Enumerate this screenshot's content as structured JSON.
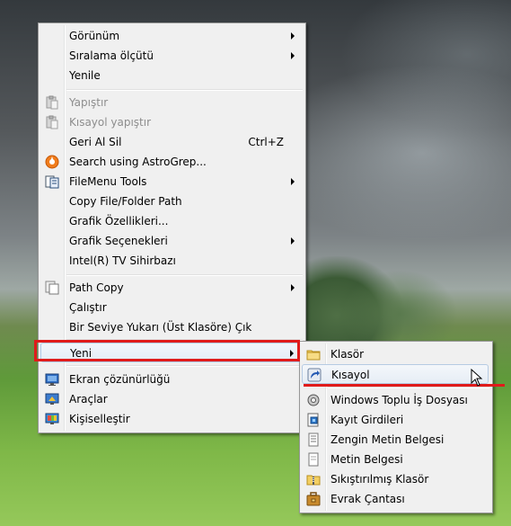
{
  "main_menu": {
    "items": [
      {
        "label": "Görünüm",
        "submenu": true
      },
      {
        "label": "Sıralama ölçütü",
        "submenu": true
      },
      {
        "label": "Yenile"
      },
      {
        "label": "Yapıştır",
        "disabled": true,
        "icon": "paste-icon"
      },
      {
        "label": "Kısayol yapıştır",
        "disabled": true,
        "icon": "paste-shortcut-icon"
      },
      {
        "label": "Geri Al Sil",
        "shortcut": "Ctrl+Z"
      },
      {
        "label": "Search using AstroGrep...",
        "icon": "astrogrep-icon"
      },
      {
        "label": "FileMenu Tools",
        "submenu": true,
        "icon": "filemenu-tools-icon"
      },
      {
        "label": "Copy File/Folder Path"
      },
      {
        "label": "Grafik Özellikleri..."
      },
      {
        "label": "Grafik Seçenekleri",
        "submenu": true
      },
      {
        "label": "Intel(R) TV Sihirbazı"
      },
      {
        "label": "Path Copy",
        "submenu": true,
        "icon": "path-copy-icon"
      },
      {
        "label": "Çalıştır"
      },
      {
        "label": "Bir Seviye Yukarı (Üst Klasöre) Çık"
      },
      {
        "label": "Yeni",
        "submenu": true,
        "active": true
      },
      {
        "label": "Ekran çözünürlüğü",
        "icon": "screen-resolution-icon"
      },
      {
        "label": "Araçlar",
        "icon": "tools-icon"
      },
      {
        "label": "Kişiselleştir",
        "icon": "personalize-icon"
      }
    ]
  },
  "new_submenu": {
    "items": [
      {
        "label": "Klasör",
        "icon": "folder-icon"
      },
      {
        "label": "Kısayol",
        "icon": "shortcut-icon",
        "hover": true
      },
      {
        "label": "Windows Toplu İş Dosyası",
        "icon": "batch-file-icon"
      },
      {
        "label": "Kayıt Girdileri",
        "icon": "registry-entries-icon"
      },
      {
        "label": "Zengin Metin Belgesi",
        "icon": "rich-text-document-icon"
      },
      {
        "label": "Metin Belgesi",
        "icon": "text-document-icon"
      },
      {
        "label": "Sıkıştırılmış Klasör",
        "icon": "compressed-folder-icon"
      },
      {
        "label": "Evrak Çantası",
        "icon": "briefcase-icon"
      }
    ]
  },
  "colors": {
    "highlight_annotation": "#e01b1b",
    "menu_background": "#f0f0f0",
    "hover_border": "#aecbea"
  }
}
